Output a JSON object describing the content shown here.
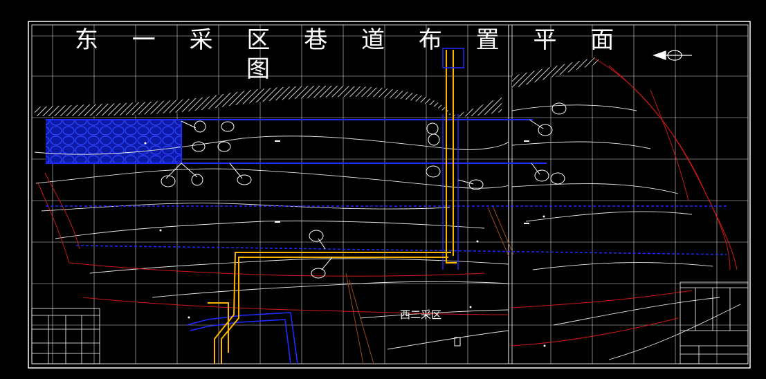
{
  "drawing": {
    "title_line1": "东 一 采 区 巷 道 布 置 平 面",
    "title_line2": "图",
    "zone_label": "西二采区"
  },
  "colors": {
    "background": "#000000",
    "frame": "#ffffff",
    "grid": "#ffffff",
    "roadway_blue": "#1e2cff",
    "shaft_orange": "#ffb400",
    "contour_white": "#e6e6e6",
    "boundary_red": "#d01818",
    "fault_brown": "#9a4a1a",
    "goaf_fill": "#0d1aa8"
  },
  "icons": [
    "compass-arrow-icon",
    "equipment-symbol-icon",
    "hatched-outcrop-band",
    "goaf-crosshatch"
  ]
}
